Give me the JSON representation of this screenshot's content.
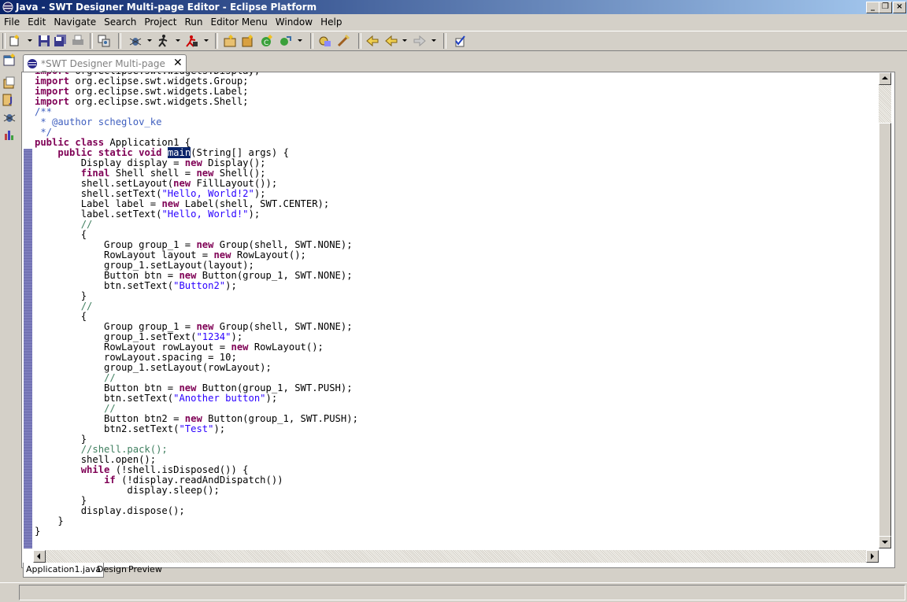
{
  "window": {
    "title": "Java - SWT Designer Multi-page Editor - Eclipse Platform",
    "minimize": "_",
    "restore": "❐",
    "close": "×"
  },
  "menu": [
    "File",
    "Edit",
    "Navigate",
    "Search",
    "Project",
    "Run",
    "Editor Menu",
    "Window",
    "Help"
  ],
  "toolbar_icons": [
    "new-wizard-icon",
    "save-icon",
    "save-all-icon",
    "print-icon",
    "open-type-icon",
    "debug-icon",
    "run-icon",
    "external-tools-icon",
    "new-java-project-icon",
    "new-package-icon",
    "new-class-icon",
    "open-type-hierarchy-icon",
    "search-icon",
    "edit-icon",
    "last-edit-location-icon",
    "back-icon",
    "forward-icon",
    "task-icon"
  ],
  "shortcut_icons": [
    "open-perspective-icon",
    "resource-perspective-icon",
    "java-perspective-icon",
    "debug-perspective-icon",
    "profile-perspective-icon"
  ],
  "editor": {
    "tab_label": "*SWT Designer Multi-page Editor",
    "tab_close": "✕",
    "bottom_tabs": [
      "Application1.java",
      "Design",
      "Preview"
    ],
    "code_lines": [
      "import org.eclipse.swt.widgets.Display;",
      "import org.eclipse.swt.widgets.Group;",
      "import org.eclipse.swt.widgets.Label;",
      "import org.eclipse.swt.widgets.Shell;",
      "/**",
      " * @author scheglov_ke",
      " */",
      "public class Application1 {",
      "    public static void main(String[] args) {",
      "        Display display = new Display();",
      "        final Shell shell = new Shell();",
      "        shell.setLayout(new FillLayout());",
      "        shell.setText(\"Hello, World!2\");",
      "        Label label = new Label(shell, SWT.CENTER);",
      "        label.setText(\"Hello, World!\");",
      "        //",
      "        {",
      "            Group group_1 = new Group(shell, SWT.NONE);",
      "            RowLayout layout = new RowLayout();",
      "            group_1.setLayout(layout);",
      "            Button btn = new Button(group_1, SWT.NONE);",
      "            btn.setText(\"Button2\");",
      "        }",
      "        //",
      "        {",
      "            Group group_1 = new Group(shell, SWT.NONE);",
      "            group_1.setText(\"1234\");",
      "            RowLayout rowLayout = new RowLayout();",
      "            rowLayout.spacing = 10;",
      "            group_1.setLayout(rowLayout);",
      "            //",
      "            Button btn = new Button(group_1, SWT.PUSH);",
      "            btn.setText(\"Another button\");",
      "            //",
      "            Button btn2 = new Button(group_1, SWT.PUSH);",
      "            btn2.setText(\"Test\");",
      "        }",
      "        //shell.pack();",
      "        shell.open();",
      "        while (!shell.isDisposed()) {",
      "            if (!display.readAndDispatch())",
      "                display.sleep();",
      "        }",
      "        display.dispose();",
      "    }",
      "}"
    ],
    "selected_word": "main"
  },
  "colors": {
    "keyword": "#7f0055",
    "string": "#2a00ff",
    "comment": "#3f7f5f",
    "javadoc": "#3f5fbf",
    "selection": "#0a246a",
    "titlebar": "#0a246a"
  }
}
